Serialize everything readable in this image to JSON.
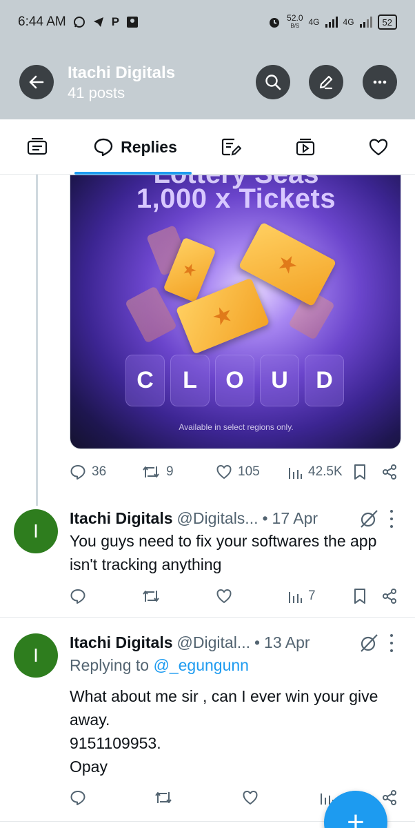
{
  "status_bar": {
    "time": "6:44 AM",
    "speed": "52.0",
    "speed_unit": "B/S",
    "net1": "4G",
    "net2": "4G",
    "battery": "52"
  },
  "header": {
    "title": "Itachi Digitals",
    "subtitle": "41 posts"
  },
  "tabs": {
    "replies_label": "Replies"
  },
  "media": {
    "headline_partial": "Lottery Seas",
    "headline": "1,000 x Tickets",
    "letters": [
      "C",
      "L",
      "O",
      "U",
      "D"
    ],
    "note": "Available in select regions only."
  },
  "post1_actions": {
    "replies": "36",
    "reposts": "9",
    "likes": "105",
    "views": "42.5K"
  },
  "tweet1": {
    "avatar_letter": "I",
    "name": "Itachi Digitals",
    "handle": "@Digitals...",
    "date": "17 Apr",
    "text": "You guys need to fix your softwares the app isn't tracking anything",
    "views": "7"
  },
  "tweet2": {
    "avatar_letter": "I",
    "name": "Itachi Digitals",
    "handle": "@Digital...",
    "date": "13 Apr",
    "replying_prefix": "Replying to",
    "replying_handle": "@_egungunn",
    "line1": "What about me sir , can I ever win your give away.",
    "line2": "9151109953.",
    "line3": "Opay"
  },
  "fab": {
    "label": "+"
  },
  "colors": {
    "accent": "#1d9bf0",
    "avatar": "#2e7d1e",
    "header_bg": "#c5cdd2"
  }
}
